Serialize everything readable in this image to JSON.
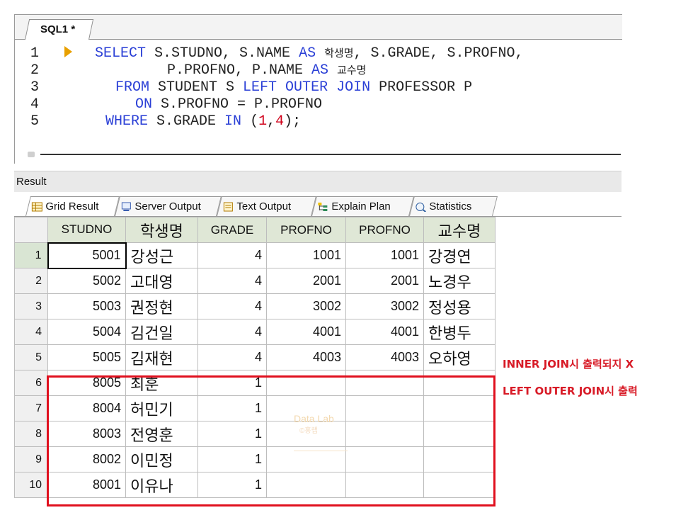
{
  "editor": {
    "tab_label": "SQL1 *",
    "line_numbers": [
      "1",
      "2",
      "3",
      "4",
      "5"
    ],
    "code": {
      "l1_kw1": "SELECT",
      "l1_a": " S.STUDNO, S.NAME ",
      "l1_kw2": "AS",
      "l1_kor": "학생명",
      "l1_b": ", S.GRADE, S.PROFNO,",
      "l2_a": "P.PROFNO, P.NAME ",
      "l2_kw": "AS",
      "l2_kor": "교수명",
      "l3_kw1": "FROM",
      "l3_a": " STUDENT S ",
      "l3_kw2": "LEFT OUTER JOIN",
      "l3_b": " PROFESSOR P",
      "l4_kw": "ON",
      "l4_a": " S.PROFNO = P.PROFNO",
      "l5_kw1": "WHERE",
      "l5_a": " S.GRADE ",
      "l5_kw2": "IN",
      "l5_b": " (",
      "l5_n1": "1",
      "l5_c": ",",
      "l5_n2": "4",
      "l5_d": ");"
    }
  },
  "result": {
    "label": "Result",
    "tabs": [
      {
        "label": "Grid Result",
        "icon": "grid-icon"
      },
      {
        "label": "Server Output",
        "icon": "server-output-icon"
      },
      {
        "label": "Text Output",
        "icon": "text-output-icon"
      },
      {
        "label": "Explain Plan",
        "icon": "explain-plan-icon"
      },
      {
        "label": "Statistics",
        "icon": "statistics-icon"
      }
    ],
    "columns": [
      "STUDNO",
      "학생명",
      "GRADE",
      "PROFNO",
      "PROFNO",
      "교수명"
    ],
    "rows": [
      {
        "n": "1",
        "studno": "5001",
        "name": "강성근",
        "grade": "4",
        "profno1": "1001",
        "profno2": "1001",
        "prof": "강경연"
      },
      {
        "n": "2",
        "studno": "5002",
        "name": "고대영",
        "grade": "4",
        "profno1": "2001",
        "profno2": "2001",
        "prof": "노경우"
      },
      {
        "n": "3",
        "studno": "5003",
        "name": "권정현",
        "grade": "4",
        "profno1": "3002",
        "profno2": "3002",
        "prof": "정성용"
      },
      {
        "n": "4",
        "studno": "5004",
        "name": "김건일",
        "grade": "4",
        "profno1": "4001",
        "profno2": "4001",
        "prof": "한병두"
      },
      {
        "n": "5",
        "studno": "5005",
        "name": "김재현",
        "grade": "4",
        "profno1": "4003",
        "profno2": "4003",
        "prof": "오하영"
      },
      {
        "n": "6",
        "studno": "8005",
        "name": "최훈",
        "grade": "1",
        "profno1": "",
        "profno2": "",
        "prof": ""
      },
      {
        "n": "7",
        "studno": "8004",
        "name": "허민기",
        "grade": "1",
        "profno1": "",
        "profno2": "",
        "prof": ""
      },
      {
        "n": "8",
        "studno": "8003",
        "name": "전영훈",
        "grade": "1",
        "profno1": "",
        "profno2": "",
        "prof": ""
      },
      {
        "n": "9",
        "studno": "8002",
        "name": "이민정",
        "grade": "1",
        "profno1": "",
        "profno2": "",
        "prof": ""
      },
      {
        "n": "10",
        "studno": "8001",
        "name": "이유나",
        "grade": "1",
        "profno1": "",
        "profno2": "",
        "prof": ""
      }
    ]
  },
  "annotations": {
    "inner_join": "INNER JOIN시 출력되지 X",
    "left_outer_join": "LEFT OUTER JOIN시 출력",
    "color": "#d81b27"
  },
  "watermark": {
    "line1": "Data Lab",
    "line2": "©홍랩"
  },
  "colors": {
    "keyword": "#2a3fd6",
    "number": "#d0021b",
    "header_bg": "#dfe7d6",
    "highlight_border": "#e0101e"
  }
}
